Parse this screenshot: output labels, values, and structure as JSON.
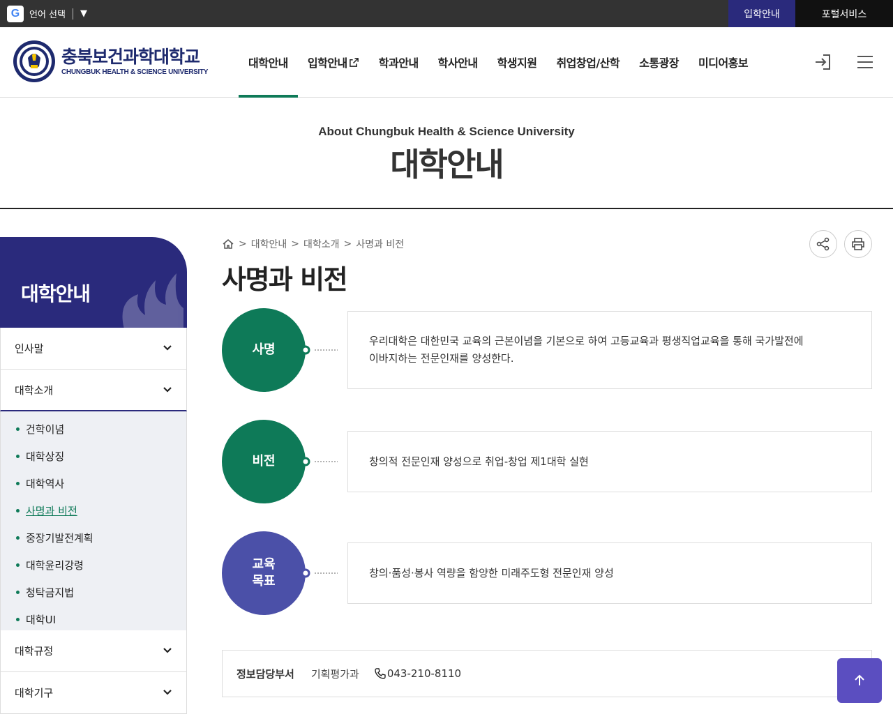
{
  "topbar": {
    "lang_label": "언어 선택",
    "admission": "입학안내",
    "portal": "포털서비스"
  },
  "header": {
    "logo_ko": "충북보건과학대학교",
    "logo_en": "CHUNGBUK HEALTH & SCIENCE UNIVERSITY",
    "nav": [
      "대학안내",
      "입학안내",
      "학과안내",
      "학사안내",
      "학생지원",
      "취업창업/산학",
      "소통광장",
      "미디어홍보"
    ]
  },
  "page_title": {
    "en": "About Chungbuk Health & Science University",
    "ko": "대학안내"
  },
  "side": {
    "title": "대학안내",
    "menus": [
      "인사말",
      "대학소개",
      "대학규정",
      "대학기구"
    ],
    "sub_items": [
      "건학이념",
      "대학상징",
      "대학역사",
      "사명과 비전",
      "중장기발전계획",
      "대학윤리강령",
      "청탁금지법",
      "대학UI"
    ]
  },
  "breadcrumb": [
    "대학안내",
    "대학소개",
    "사명과 비전"
  ],
  "content": {
    "heading": "사명과 비전",
    "mission_label": "사명",
    "mission_text": "우리대학은 대한민국 교육의 근본이념을 기본으로 하여 고등교육과 평생직업교육을 통해 국가발전에 이바지하는 전문인재를 양성한다.",
    "vision_label": "비전",
    "vision_text": "창의적 전문인재 양성으로 취업-창업 제1대학 실현",
    "edu_label_1": "교육",
    "edu_label_2": "목표",
    "edu_text": "창의·품성·봉사 역량을 함양한 미래주도형 전문인재 양성"
  },
  "info": {
    "label": "정보담당부서",
    "dept": "기획평가과",
    "phone": "043-210-8110"
  },
  "colors": {
    "navy": "#2a2a7c",
    "green": "#0e7a58",
    "blue": "#4b50a8",
    "top_button": "#5b4ec0"
  }
}
